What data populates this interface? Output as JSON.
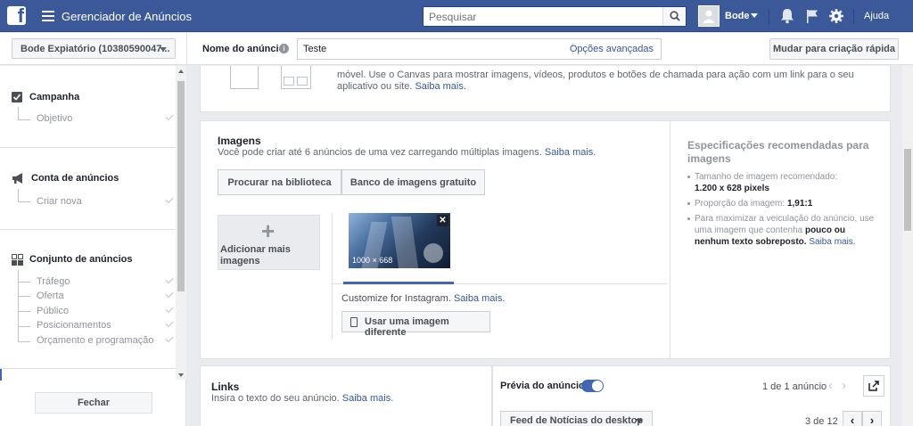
{
  "topbar": {
    "app_title": "Gerenciador de Anúncios",
    "search_placeholder": "Pesquisar",
    "user": "Bode",
    "help": "Ajuda",
    "logo": "f"
  },
  "toolbar": {
    "account": "Bode Expiatório (10380590047...",
    "name_label": "Nome do anúncio",
    "name_value": "Teste",
    "advanced": "Opções avançadas",
    "quick_create": "Mudar para criação rápida"
  },
  "sidebar": {
    "campaign": {
      "title": "Campanha",
      "items": [
        "Objetivo"
      ]
    },
    "account": {
      "title": "Conta de anúncios",
      "items": [
        "Criar nova"
      ]
    },
    "adset": {
      "title": "Conjunto de anúncios",
      "items": [
        "Tráfego",
        "Oferta",
        "Público",
        "Posicionamentos",
        "Orçamento e programação"
      ]
    },
    "close": "Fechar"
  },
  "canvas_card": {
    "text": "móvel. Use o Canvas para mostrar imagens, vídeos, produtos e botões de chamada para ação com um link para o seu aplicativo ou site.",
    "link": "Saiba mais."
  },
  "images": {
    "title": "Imagens",
    "subtitle": "Você pode criar até 6 anúncios de uma vez carregando múltiplas imagens.",
    "subtitle_link": "Saiba mais.",
    "tab_library": "Procurar na biblioteca",
    "tab_free": "Banco de imagens gratuito",
    "add_more": "Adicionar mais imagens",
    "dimensions": "1000 × 668",
    "remove": "✕",
    "instagram": "Customize for Instagram.",
    "instagram_link": "Saiba mais.",
    "use_different": "Usar uma imagem diferente"
  },
  "specs": {
    "title": "Especificações recomendadas para imagens",
    "size_label": "Tamanho de imagem recomendado:",
    "size_value": "1.200 x 628 pixels",
    "ratio_label": "Proporção da imagem:",
    "ratio_value": "1,91:1",
    "tip_pre": "Para maximizar a veiculação do anúncio, use uma imagem que contenha",
    "tip_bold": "pouco ou nenhum texto sobreposto.",
    "tip_link": "Saiba mais."
  },
  "links": {
    "title": "Links",
    "subtitle": "Insira o texto do seu anúncio.",
    "subtitle_link": "Saiba mais."
  },
  "preview": {
    "label": "Prévia do anúncio",
    "enabled": true,
    "count": "1 de 1 anúncio",
    "placement": "Feed de Notícias do desktop",
    "page": "3 de 12",
    "prev": "‹",
    "next": "›"
  },
  "colors": {
    "brand": "#3b5998",
    "link": "#365899",
    "accent": "#4267b2"
  }
}
